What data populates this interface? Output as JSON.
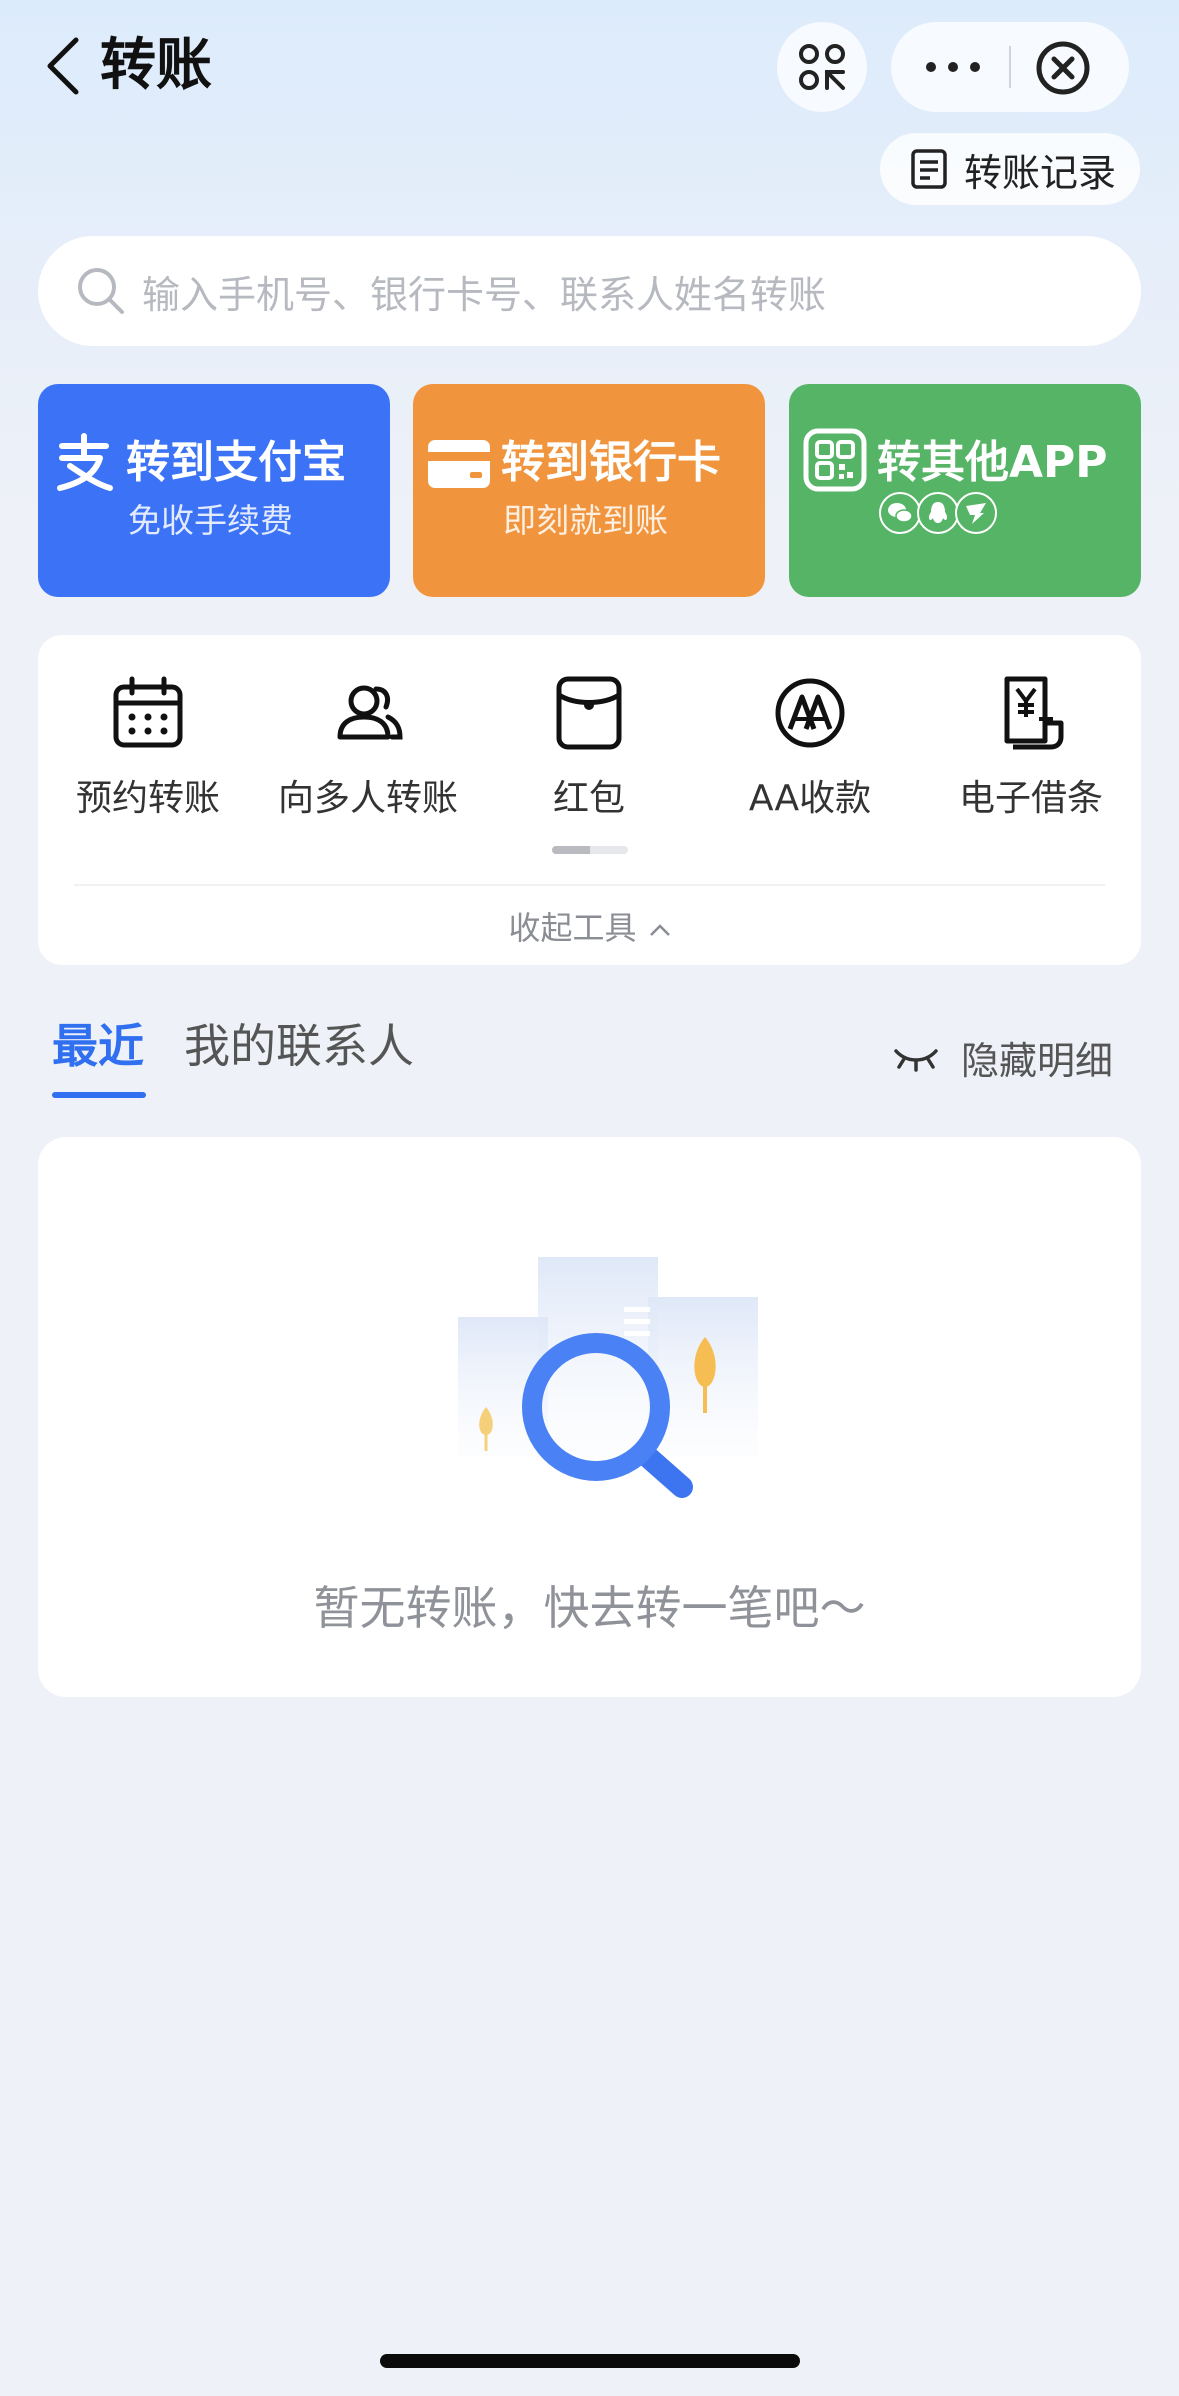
{
  "header": {
    "title": "转账",
    "records_label": "转账记录"
  },
  "search": {
    "placeholder": "输入手机号、银行卡号、联系人姓名转账"
  },
  "cards": [
    {
      "title": "转到支付宝",
      "subtitle": "免收手续费",
      "color": "#3c72f5",
      "icon": "alipay-icon"
    },
    {
      "title": "转到银行卡",
      "subtitle": "即刻就到账",
      "color": "#f0953d",
      "icon": "bank-card-icon"
    },
    {
      "title": "转其他APP",
      "subtitle": "",
      "color": "#56b466",
      "icon": "qr-code-icon",
      "badges": [
        "wechat-icon",
        "qq-icon",
        "dingtalk-icon"
      ]
    }
  ],
  "tools": {
    "items": [
      {
        "label": "预约转账",
        "icon": "calendar-icon"
      },
      {
        "label": "向多人转账",
        "icon": "multi-user-icon"
      },
      {
        "label": "红包",
        "icon": "red-packet-icon"
      },
      {
        "label": "AA收款",
        "icon": "aa-icon"
      },
      {
        "label": "电子借条",
        "icon": "iou-icon"
      }
    ],
    "page_progress": 0.5,
    "collapse_label": "收起工具"
  },
  "tabs": {
    "recent": "最近",
    "contacts": "我的联系人",
    "active": "recent",
    "hide_label": "隐藏明细"
  },
  "empty": {
    "message": "暂无转账，快去转一笔吧～"
  },
  "colors": {
    "accent": "#2f6ff0"
  }
}
